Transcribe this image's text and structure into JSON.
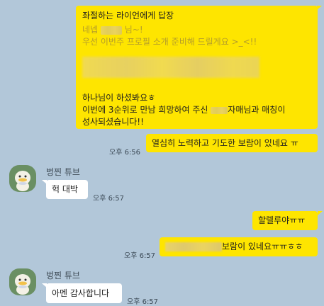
{
  "chat": {
    "messages": [
      {
        "id": "m1",
        "side": "right",
        "type": "reply",
        "reply_header": "좌절하는 라이언에게 답장",
        "quoted_lines": [
          "네넵",
          "님~!",
          "우선 이번주 프로필 소개 준비해 드릴게요 >_<!!"
        ],
        "body_lines": [
          "하나님이 하셨봐요ㅎ",
          "이번에 3순위로 만남 희망하여 주신",
          "자매님과 매칭이",
          "성사되셨습니다!!"
        ],
        "time": ""
      },
      {
        "id": "m2",
        "side": "right",
        "text": "열심히 노력하고 기도한 보람이 있네요 ㅠ",
        "time": "오후 6:56"
      },
      {
        "id": "m3",
        "side": "left",
        "sender": "벙찐 튜브",
        "text": "헉 대박",
        "time": "오후 6:57"
      },
      {
        "id": "m4",
        "side": "right",
        "text": "할렐루야ㅠㅠ",
        "time": ""
      },
      {
        "id": "m5",
        "side": "right",
        "text": "보람이 있네요ㅠㅠㅎㅎ",
        "time": "오후 6:57"
      },
      {
        "id": "m6",
        "side": "left",
        "sender": "벙찐 튜브",
        "text": "아멘 감사합니다",
        "time": "오후 6:57"
      }
    ]
  },
  "colors": {
    "background": "#b2c7d9",
    "my_bubble": "#fee500",
    "their_bubble": "#ffffff",
    "avatar_bg": "#6a8f63"
  },
  "icons": {
    "avatar": "tube-duck-avatar-icon"
  }
}
